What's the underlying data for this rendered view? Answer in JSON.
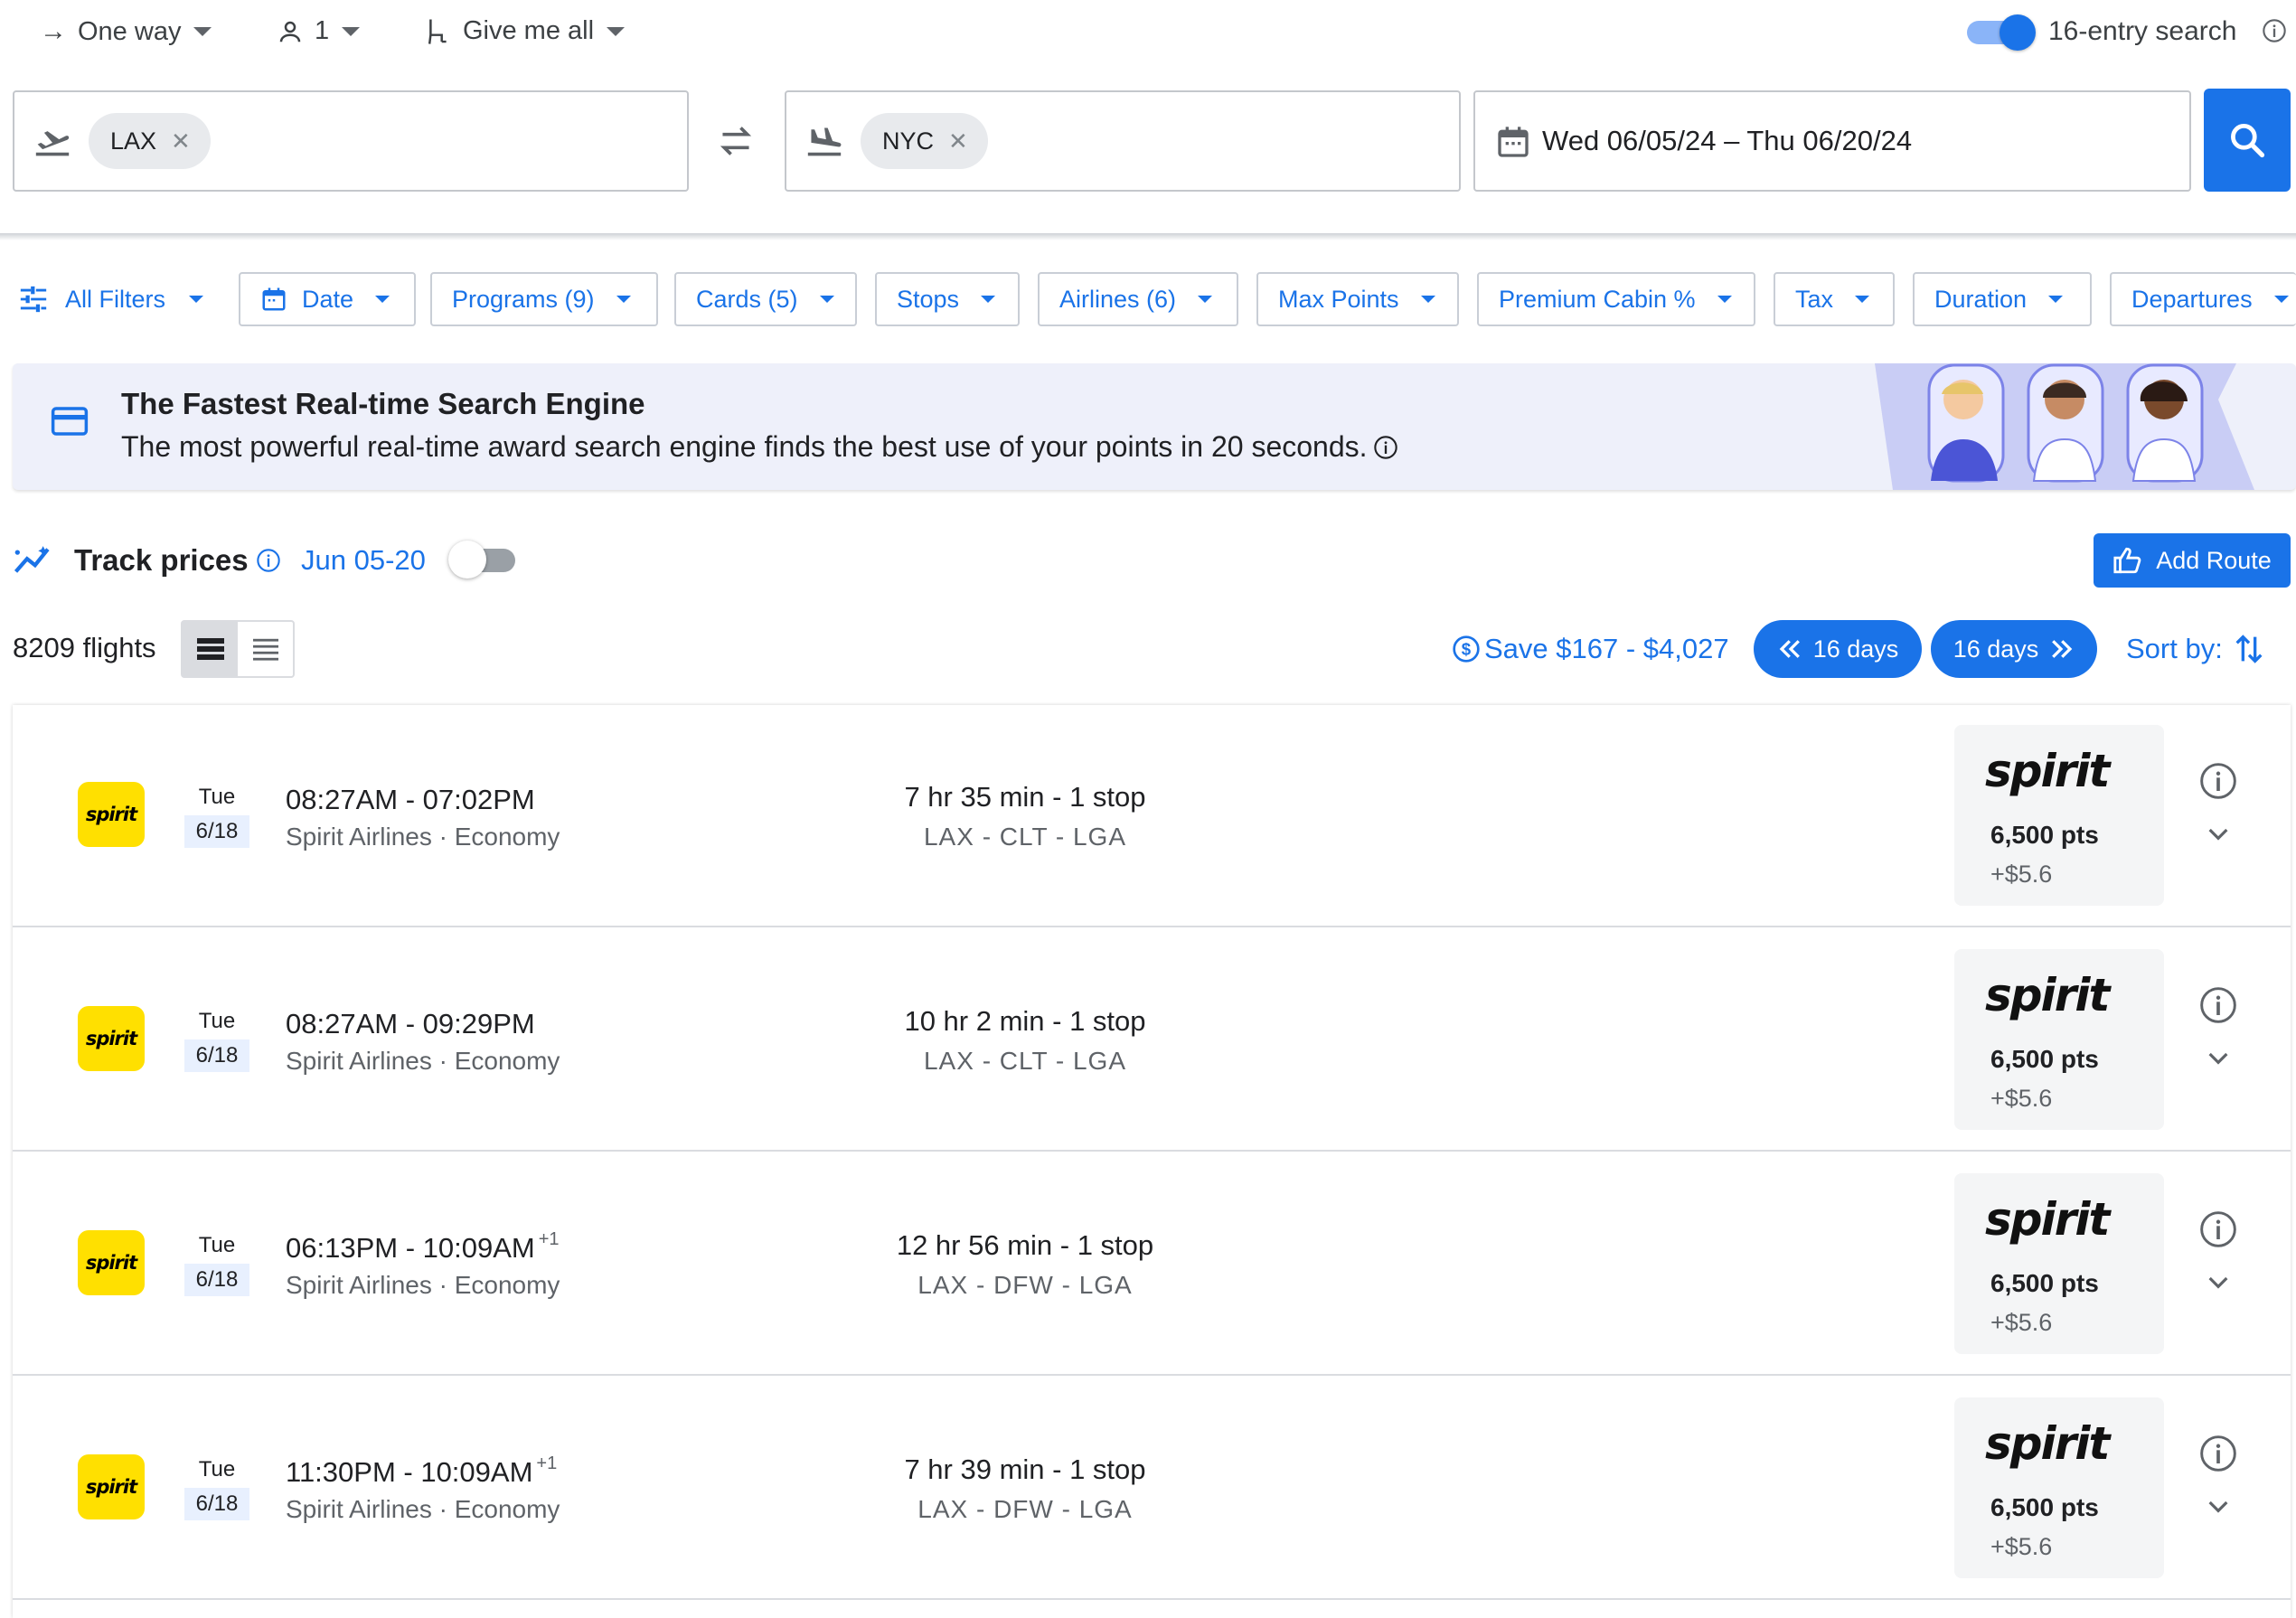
{
  "top_bar": {
    "trip_type": "One way",
    "passengers": "1",
    "cabin": "Give me all",
    "entry_search_label": "16-entry search",
    "entry_search_on": true
  },
  "search": {
    "origin": "LAX",
    "destination": "NYC",
    "dates": "Wed 06/05/24 – Thu 06/20/24"
  },
  "filters": [
    {
      "label": "All Filters"
    },
    {
      "label": "Date"
    },
    {
      "label": "Programs (9)"
    },
    {
      "label": "Cards (5)"
    },
    {
      "label": "Stops"
    },
    {
      "label": "Airlines (6)"
    },
    {
      "label": "Max Points"
    },
    {
      "label": "Premium Cabin %"
    },
    {
      "label": "Tax"
    },
    {
      "label": "Duration"
    },
    {
      "label": "Departures"
    }
  ],
  "banner": {
    "title": "The Fastest Real-time Search Engine",
    "subtitle": "The most powerful real-time award search engine finds the best use of your points in 20 seconds."
  },
  "track_prices": {
    "title": "Track prices",
    "date_range": "Jun 05-20",
    "enabled": false,
    "add_route_label": "Add Route"
  },
  "results_bar": {
    "count": "8209 flights",
    "save_range": "Save $167 - $4,027",
    "prev_days": "16 days",
    "next_days": "16 days",
    "sort_label": "Sort by:"
  },
  "flights": [
    {
      "logo_text": "spirit",
      "dow": "Tue",
      "date": "6/18",
      "times": "08:27AM - 07:02PM",
      "day_offset": "",
      "airline_cabin": "Spirit Airlines · Economy",
      "duration": "7 hr 35 min - 1 stop",
      "route": "LAX - CLT - LGA",
      "brand": "spirit",
      "points": "6,500 pts",
      "tax": "+$5.6"
    },
    {
      "logo_text": "spirit",
      "dow": "Tue",
      "date": "6/18",
      "times": "08:27AM - 09:29PM",
      "day_offset": "",
      "airline_cabin": "Spirit Airlines · Economy",
      "duration": "10 hr 2 min - 1 stop",
      "route": "LAX - CLT - LGA",
      "brand": "spirit",
      "points": "6,500 pts",
      "tax": "+$5.6"
    },
    {
      "logo_text": "spirit",
      "dow": "Tue",
      "date": "6/18",
      "times": "06:13PM - 10:09AM",
      "day_offset": "+1",
      "airline_cabin": "Spirit Airlines · Economy",
      "duration": "12 hr 56 min - 1 stop",
      "route": "LAX - DFW - LGA",
      "brand": "spirit",
      "points": "6,500 pts",
      "tax": "+$5.6"
    },
    {
      "logo_text": "spirit",
      "dow": "Tue",
      "date": "6/18",
      "times": "11:30PM - 10:09AM",
      "day_offset": "+1",
      "airline_cabin": "Spirit Airlines · Economy",
      "duration": "7 hr 39 min - 1 stop",
      "route": "LAX - DFW - LGA",
      "brand": "spirit",
      "points": "6,500 pts",
      "tax": "+$5.6"
    }
  ],
  "colors": {
    "accent": "#1a73e8",
    "spirit_yellow": "#ffe000",
    "banner_bg": "#eef0fa"
  },
  "icons": {
    "arrow-right-icon": "→",
    "person-icon": "person",
    "seat-icon": "seat",
    "info-icon": "ⓘ",
    "takeoff-icon": "plane-takeoff",
    "landing-icon": "plane-landing",
    "swap-icon": "⇄",
    "calendar-icon": "calendar",
    "search-icon": "magnifier",
    "filter-icon": "sliders",
    "card-icon": "credit-card",
    "trend-icon": "sparkline",
    "thumbs-up-icon": "thumbs-up",
    "list-dense-icon": "list",
    "list-compact-icon": "list",
    "dollar-circle-icon": "$",
    "double-chevron-left-icon": "«",
    "double-chevron-right-icon": "»",
    "sort-icon": "sort-arrows",
    "chevron-down-icon": "chevron-down"
  }
}
